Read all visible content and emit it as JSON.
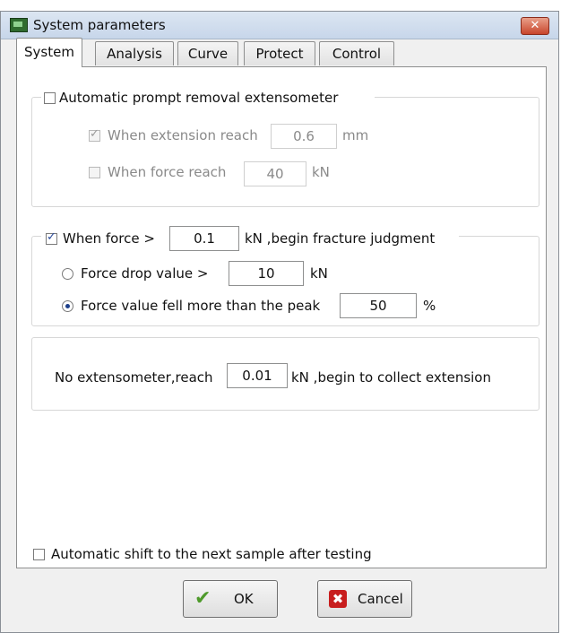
{
  "window": {
    "title": "System parameters",
    "close_glyph": "✕"
  },
  "tabs": [
    {
      "label": "System",
      "active": true
    },
    {
      "label": "Analysis",
      "active": false
    },
    {
      "label": "Curve",
      "active": false
    },
    {
      "label": "Protect",
      "active": false
    },
    {
      "label": "Control",
      "active": false
    }
  ],
  "extensometer_group": {
    "label": "Automatic prompt removal extensometer",
    "checked": false,
    "extension": {
      "label": "When extension reach",
      "value": "0.6",
      "unit": "mm",
      "checked": true,
      "enabled": false
    },
    "force": {
      "label": "When force reach",
      "value": "40",
      "unit": "kN",
      "checked": false,
      "enabled": false
    }
  },
  "fracture_group": {
    "prefix": "When force >",
    "value": "0.1",
    "suffix": "kN ,begin fracture judgment",
    "checked": true,
    "drop": {
      "label": "Force drop value >",
      "value": "10",
      "unit": "kN",
      "selected": false
    },
    "peak": {
      "label": "Force value fell more than the peak",
      "value": "50",
      "unit": "%",
      "selected": true
    }
  },
  "collect_group": {
    "prefix": "No extensometer,reach",
    "value": "0.01",
    "suffix": "kN ,begin to collect extension"
  },
  "auto_shift": {
    "label": "Automatic shift to the next sample after testing",
    "checked": false
  },
  "buttons": {
    "ok": "OK",
    "cancel": "Cancel",
    "ok_glyph": "✔",
    "cancel_glyph": "✖"
  }
}
